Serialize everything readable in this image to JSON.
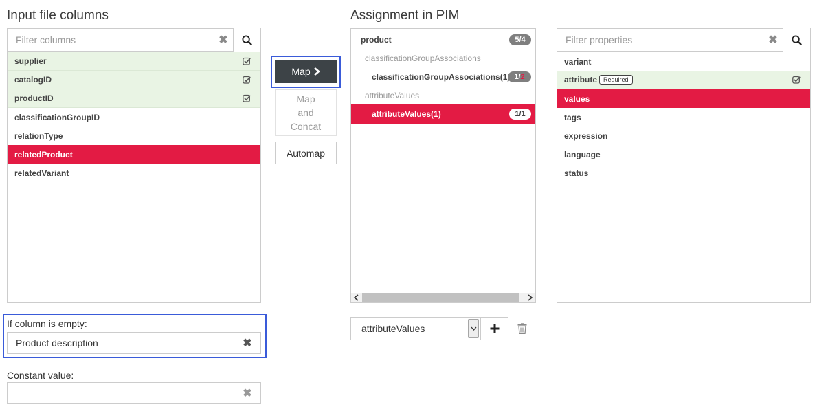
{
  "left": {
    "title": "Input file columns",
    "filter_placeholder": "Filter columns",
    "clear_glyph": "✖",
    "columns": [
      {
        "label": "supplier",
        "state": "mapped"
      },
      {
        "label": "catalogID",
        "state": "mapped"
      },
      {
        "label": "productID",
        "state": "mapped"
      },
      {
        "label": "classificationGroupID",
        "state": "normal"
      },
      {
        "label": "relationType",
        "state": "normal"
      },
      {
        "label": "relatedProduct",
        "state": "selected"
      },
      {
        "label": "relatedVariant",
        "state": "normal"
      }
    ],
    "empty_label": "If column is empty:",
    "empty_value": "Product description",
    "constant_label": "Constant value:",
    "constant_value": ""
  },
  "actions": {
    "map_label": "Map",
    "map_concat_lines": [
      "Map",
      "and",
      "Concat"
    ],
    "automap_label": "Automap"
  },
  "pim": {
    "title": "Assignment in PIM",
    "tree": {
      "root_label": "product",
      "root_badge": "5/4",
      "group1_label": "classificationGroupAssociations",
      "item1_label": "classificationGroupAssociations(1)",
      "item1_badge_a": "1/",
      "item1_badge_b": "2",
      "group2_label": "attributeValues",
      "item2_label": "attributeValues(1)",
      "item2_badge": "1/1"
    },
    "select_value": "attributeValues",
    "select_options": [
      "attributeValues"
    ]
  },
  "props": {
    "filter_placeholder": "Filter properties",
    "clear_glyph": "✖",
    "items": [
      {
        "label": "variant",
        "state": "normal"
      },
      {
        "label": "attribute",
        "state": "mapped",
        "tag": "Required"
      },
      {
        "label": "values",
        "state": "selected"
      },
      {
        "label": "tags",
        "state": "normal"
      },
      {
        "label": "expression",
        "state": "normal"
      },
      {
        "label": "language",
        "state": "normal"
      },
      {
        "label": "status",
        "state": "normal"
      }
    ]
  },
  "colors": {
    "accent_red": "#e31b44",
    "mapped_green": "#e9f4e4",
    "focus_blue": "#3a5bd9",
    "dark_button": "#3d4347"
  },
  "icons": {
    "search": "search-icon",
    "clear": "clear-icon",
    "check": "check-square-icon",
    "chevron_right": "chevron-right-icon",
    "plus": "plus-icon",
    "trash": "trash-icon",
    "scroll_left": "scroll-left-icon",
    "scroll_right": "scroll-right-icon",
    "dropdown": "chevron-down-icon"
  }
}
